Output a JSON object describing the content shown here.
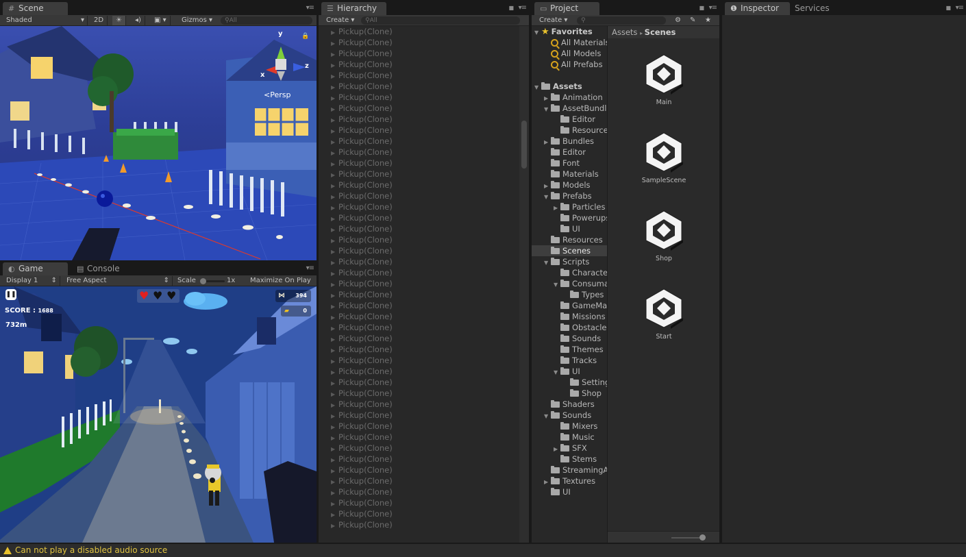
{
  "scene": {
    "tab": "Scene",
    "shading": "Shaded",
    "mode_2d": "2D",
    "gizmos": "Gizmos",
    "search_placeholder": "All",
    "persp": "Persp",
    "axes": {
      "x": "x",
      "y": "y",
      "z": "z"
    }
  },
  "game": {
    "tab": "Game",
    "console_tab": "Console",
    "display": "Display 1",
    "aspect": "Free Aspect",
    "scale_label": "Scale",
    "scale_value": "1x",
    "maximize": "Maximize On Play",
    "score_label": "SCORE :",
    "score": "1688",
    "distance": "732m",
    "fish_count": "394",
    "premium_count": "0"
  },
  "hierarchy": {
    "tab": "Hierarchy",
    "create": "Create",
    "search_placeholder": "All",
    "rows": [
      "Pickup(Clone)",
      "Pickup(Clone)",
      "Pickup(Clone)",
      "Pickup(Clone)",
      "Pickup(Clone)",
      "Pickup(Clone)",
      "Pickup(Clone)",
      "Pickup(Clone)",
      "Pickup(Clone)",
      "Pickup(Clone)",
      "Pickup(Clone)",
      "Pickup(Clone)",
      "Pickup(Clone)",
      "Pickup(Clone)",
      "Pickup(Clone)",
      "Pickup(Clone)",
      "Pickup(Clone)",
      "Pickup(Clone)",
      "Pickup(Clone)",
      "Pickup(Clone)",
      "Pickup(Clone)",
      "Pickup(Clone)",
      "Pickup(Clone)",
      "Pickup(Clone)",
      "Pickup(Clone)",
      "Pickup(Clone)",
      "Pickup(Clone)",
      "Pickup(Clone)",
      "Pickup(Clone)",
      "Pickup(Clone)",
      "Pickup(Clone)",
      "Pickup(Clone)",
      "Pickup(Clone)",
      "Pickup(Clone)",
      "Pickup(Clone)",
      "Pickup(Clone)",
      "Pickup(Clone)",
      "Pickup(Clone)",
      "Pickup(Clone)",
      "Pickup(Clone)",
      "Pickup(Clone)",
      "Pickup(Clone)",
      "Pickup(Clone)",
      "Pickup(Clone)",
      "Pickup(Clone)",
      "Pickup(Clone)"
    ]
  },
  "project": {
    "tab": "Project",
    "create": "Create",
    "breadcrumb_root": "Assets",
    "breadcrumb_current": "Scenes",
    "tree": [
      {
        "label": "Favorites",
        "indent": 0,
        "arrow": "down",
        "icon": "star",
        "bold": true
      },
      {
        "label": "All Materials",
        "indent": 1,
        "arrow": "",
        "icon": "search"
      },
      {
        "label": "All Models",
        "indent": 1,
        "arrow": "",
        "icon": "search"
      },
      {
        "label": "All Prefabs",
        "indent": 1,
        "arrow": "",
        "icon": "search"
      },
      {
        "label": "",
        "indent": 0,
        "arrow": "",
        "icon": "none"
      },
      {
        "label": "Assets",
        "indent": 0,
        "arrow": "down",
        "icon": "folder",
        "bold": true
      },
      {
        "label": "Animation",
        "indent": 1,
        "arrow": "right",
        "icon": "folder"
      },
      {
        "label": "AssetBundles",
        "indent": 1,
        "arrow": "down",
        "icon": "folder"
      },
      {
        "label": "Editor",
        "indent": 2,
        "arrow": "",
        "icon": "folder"
      },
      {
        "label": "Resources",
        "indent": 2,
        "arrow": "",
        "icon": "folder"
      },
      {
        "label": "Bundles",
        "indent": 1,
        "arrow": "right",
        "icon": "folder"
      },
      {
        "label": "Editor",
        "indent": 1,
        "arrow": "",
        "icon": "folder"
      },
      {
        "label": "Font",
        "indent": 1,
        "arrow": "",
        "icon": "folder"
      },
      {
        "label": "Materials",
        "indent": 1,
        "arrow": "",
        "icon": "folder"
      },
      {
        "label": "Models",
        "indent": 1,
        "arrow": "right",
        "icon": "folder"
      },
      {
        "label": "Prefabs",
        "indent": 1,
        "arrow": "down",
        "icon": "folder"
      },
      {
        "label": "Particles",
        "indent": 2,
        "arrow": "right",
        "icon": "folder"
      },
      {
        "label": "Powerups",
        "indent": 2,
        "arrow": "",
        "icon": "folder"
      },
      {
        "label": "UI",
        "indent": 2,
        "arrow": "",
        "icon": "folder"
      },
      {
        "label": "Resources",
        "indent": 1,
        "arrow": "",
        "icon": "folder"
      },
      {
        "label": "Scenes",
        "indent": 1,
        "arrow": "",
        "icon": "folder",
        "selected": true
      },
      {
        "label": "Scripts",
        "indent": 1,
        "arrow": "down",
        "icon": "folder"
      },
      {
        "label": "Characters",
        "indent": 2,
        "arrow": "",
        "icon": "folder"
      },
      {
        "label": "Consumables",
        "indent": 2,
        "arrow": "down",
        "icon": "folder"
      },
      {
        "label": "Types",
        "indent": 3,
        "arrow": "",
        "icon": "folder"
      },
      {
        "label": "GameManager",
        "indent": 2,
        "arrow": "",
        "icon": "folder"
      },
      {
        "label": "Missions",
        "indent": 2,
        "arrow": "",
        "icon": "folder"
      },
      {
        "label": "Obstacles",
        "indent": 2,
        "arrow": "",
        "icon": "folder"
      },
      {
        "label": "Sounds",
        "indent": 2,
        "arrow": "",
        "icon": "folder"
      },
      {
        "label": "Themes",
        "indent": 2,
        "arrow": "",
        "icon": "folder"
      },
      {
        "label": "Tracks",
        "indent": 2,
        "arrow": "",
        "icon": "folder"
      },
      {
        "label": "UI",
        "indent": 2,
        "arrow": "down",
        "icon": "folder"
      },
      {
        "label": "Settings",
        "indent": 3,
        "arrow": "",
        "icon": "folder"
      },
      {
        "label": "Shop",
        "indent": 3,
        "arrow": "",
        "icon": "folder"
      },
      {
        "label": "Shaders",
        "indent": 1,
        "arrow": "",
        "icon": "folder"
      },
      {
        "label": "Sounds",
        "indent": 1,
        "arrow": "down",
        "icon": "folder"
      },
      {
        "label": "Mixers",
        "indent": 2,
        "arrow": "",
        "icon": "folder"
      },
      {
        "label": "Music",
        "indent": 2,
        "arrow": "",
        "icon": "folder"
      },
      {
        "label": "SFX",
        "indent": 2,
        "arrow": "right",
        "icon": "folder"
      },
      {
        "label": "Stems",
        "indent": 2,
        "arrow": "",
        "icon": "folder"
      },
      {
        "label": "StreamingAssets",
        "indent": 1,
        "arrow": "",
        "icon": "folder"
      },
      {
        "label": "Textures",
        "indent": 1,
        "arrow": "right",
        "icon": "folder"
      },
      {
        "label": "UI",
        "indent": 1,
        "arrow": "",
        "icon": "folder"
      }
    ],
    "assets": [
      "Main",
      "SampleScene",
      "Shop",
      "Start"
    ]
  },
  "inspector": {
    "tab": "Inspector",
    "services_tab": "Services"
  },
  "status": {
    "message": "Can not play a disabled audio source"
  },
  "colors": {
    "editor_bg": "#282828",
    "warning": "#e2c441",
    "gizmo_red": "#e03a2a",
    "gizmo_green": "#7fcf3a",
    "gizmo_blue": "#3a5fe0"
  }
}
